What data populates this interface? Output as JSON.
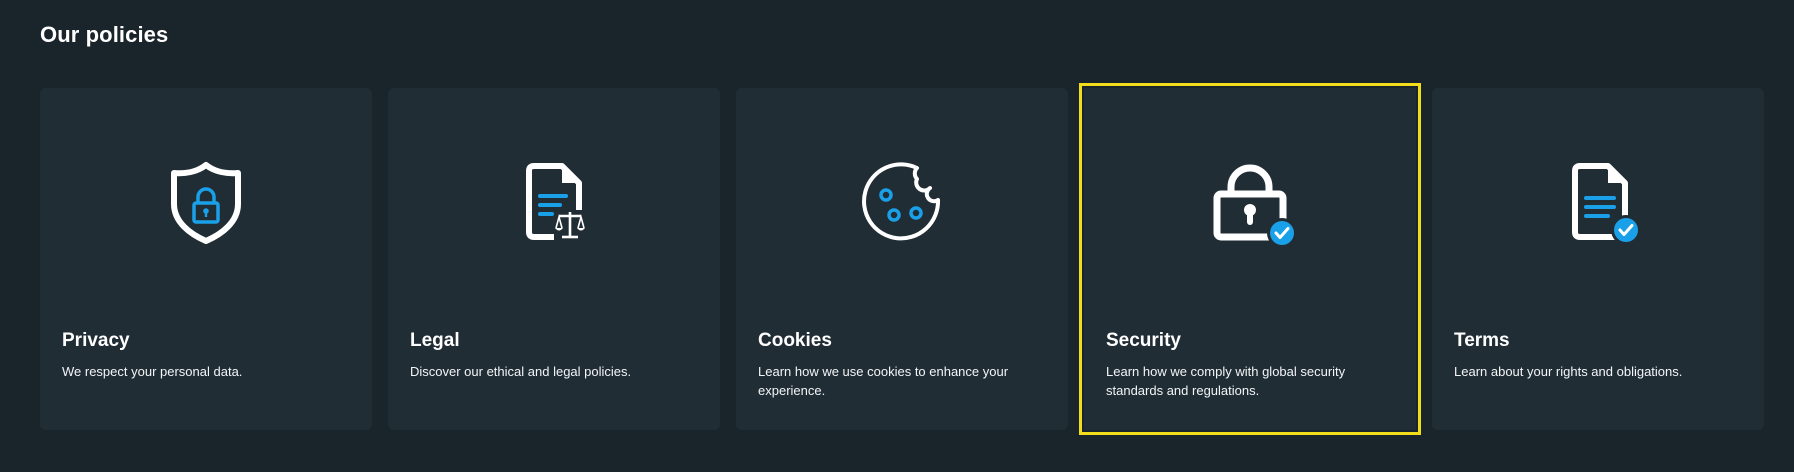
{
  "page": {
    "title": "Our policies"
  },
  "colors": {
    "background": "#1a242b",
    "card": "#212d35",
    "accent": "#1aa0e8",
    "focus_outline": "#f2dd1c"
  },
  "cards": [
    {
      "title": "Privacy",
      "description": "We respect your personal data.",
      "icon": "shield-lock-icon"
    },
    {
      "title": "Legal",
      "description": "Discover our ethical and legal policies.",
      "icon": "document-scales-icon"
    },
    {
      "title": "Cookies",
      "description": "Learn how we use cookies to enhance your experience.",
      "icon": "cookie-icon"
    },
    {
      "title": "Security",
      "description": "Learn how we comply with global security standards and regulations.",
      "icon": "padlock-check-icon",
      "focused": true
    },
    {
      "title": "Terms",
      "description": "Learn about your rights and obligations.",
      "icon": "document-check-icon"
    }
  ]
}
